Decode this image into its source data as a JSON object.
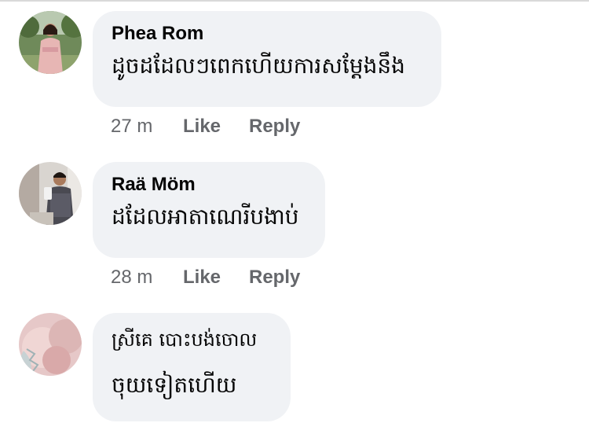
{
  "comments": [
    {
      "author": "Phea Rom",
      "text": "ដូចដដែលៗពេកហើយការសម្ដែងនឹង",
      "time": "27 m",
      "like": "Like",
      "reply": "Reply",
      "avatar": "woman-in-pink-dress-avatar"
    },
    {
      "author": "Raä Möm",
      "text": "ដដែលអាតាណេរីបងាប់",
      "time": "28 m",
      "like": "Like",
      "reply": "Reply",
      "avatar": "man-selfie-avatar"
    },
    {
      "author": "",
      "text_line1": "ស្រីគេ បោះបង់ចោល",
      "text_line2": "ចុយទៀតហើយ",
      "avatar": "pink-blurred-avatar"
    }
  ]
}
